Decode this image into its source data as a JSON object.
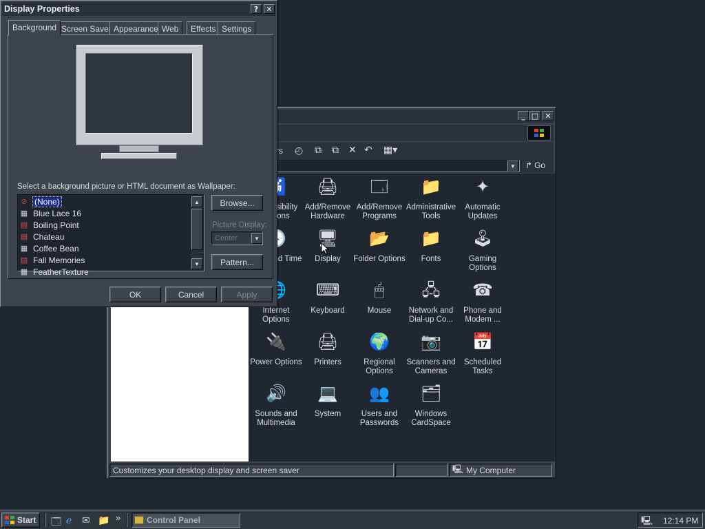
{
  "colors": {
    "desktop": "#1f2630",
    "face": "#3d444e",
    "selection": "#1a2b8a",
    "left_pane": "#ffffff"
  },
  "display_properties": {
    "title": "Display Properties",
    "help_caption": "?",
    "close_caption": "✕",
    "tabs": [
      "Background",
      "Screen Saver",
      "Appearance",
      "Web",
      "Effects",
      "Settings"
    ],
    "active_tab": "Background",
    "wallpaper_prompt": "Select a background picture or HTML document as Wallpaper:",
    "wallpapers": [
      {
        "name": "(None)",
        "icon": "none-icon",
        "selected": true
      },
      {
        "name": "Blue Lace 16",
        "icon": "bitmap-icon"
      },
      {
        "name": "Boiling Point",
        "icon": "html-doc-icon"
      },
      {
        "name": "Chateau",
        "icon": "html-doc-icon"
      },
      {
        "name": "Coffee Bean",
        "icon": "bitmap-icon"
      },
      {
        "name": "Fall Memories",
        "icon": "html-doc-icon"
      },
      {
        "name": "FeatherTexture",
        "icon": "bitmap-icon"
      }
    ],
    "browse_label": "Browse...",
    "picture_display_label": "Picture Display:",
    "picture_display_value": "Center",
    "pattern_label": "Pattern...",
    "ok_label": "OK",
    "cancel_label": "Cancel",
    "apply_label": "Apply"
  },
  "control_panel": {
    "caption_buttons": {
      "minimize": "_",
      "maximize": "□",
      "close": "✕"
    },
    "toolbar_partial_text": "rs",
    "go_label": "Go",
    "items": [
      {
        "label": "Accessibility\nOptions",
        "icon": "accessibility-icon",
        "partial": true,
        "glyph": "♿"
      },
      {
        "label": "Add/Remove\nHardware",
        "icon": "hardware-icon",
        "glyph": "🖨"
      },
      {
        "label": "Add/Remove\nPrograms",
        "icon": "programs-icon",
        "glyph": "🗔"
      },
      {
        "label": "Administrative\nTools",
        "icon": "admin-tools-icon",
        "glyph": "📁"
      },
      {
        "label": "Automatic\nUpdates",
        "icon": "windows-update-icon",
        "glyph": "✦"
      },
      {
        "label": "Date and Time",
        "icon": "date-time-icon",
        "partial": true,
        "glyph": "🕓"
      },
      {
        "label": "Display",
        "icon": "display-icon",
        "glyph": "🖥"
      },
      {
        "label": "Folder Options",
        "icon": "folder-options-icon",
        "glyph": "📂"
      },
      {
        "label": "Fonts",
        "icon": "fonts-icon",
        "glyph": "📁"
      },
      {
        "label": "Gaming\nOptions",
        "icon": "joystick-icon",
        "glyph": "🕹"
      },
      {
        "label": "Internet\nOptions",
        "icon": "internet-options-icon",
        "glyph": "🌐"
      },
      {
        "label": "Keyboard",
        "icon": "keyboard-icon",
        "glyph": "⌨"
      },
      {
        "label": "Mouse",
        "icon": "mouse-icon",
        "glyph": "🖱"
      },
      {
        "label": "Network and\nDial-up Co...",
        "icon": "network-icon",
        "glyph": "🖧"
      },
      {
        "label": "Phone and\nModem ...",
        "icon": "phone-icon",
        "glyph": "☎"
      },
      {
        "label": "Power Options",
        "icon": "power-icon",
        "glyph": "🔌"
      },
      {
        "label": "Printers",
        "icon": "printers-icon",
        "glyph": "🖨"
      },
      {
        "label": "Regional\nOptions",
        "icon": "globe-icon",
        "glyph": "🌍"
      },
      {
        "label": "Scanners and\nCameras",
        "icon": "scanner-icon",
        "glyph": "📷"
      },
      {
        "label": "Scheduled\nTasks",
        "icon": "scheduled-tasks-icon",
        "glyph": "📅"
      },
      {
        "label": "Sounds and\nMultimedia",
        "icon": "speaker-icon",
        "glyph": "🔊"
      },
      {
        "label": "System",
        "icon": "system-icon",
        "glyph": "💻"
      },
      {
        "label": "Users and\nPasswords",
        "icon": "users-icon",
        "glyph": "👥"
      },
      {
        "label": "Windows\nCardSpace",
        "icon": "cardspace-icon",
        "glyph": "🗂"
      }
    ],
    "status_text": "Customizes your desktop display and screen saver",
    "status_zone": "My Computer"
  },
  "taskbar": {
    "start_label": "Start",
    "quicklaunch_more": "»",
    "task_label": "Control Panel",
    "clock": "12:14 PM"
  }
}
